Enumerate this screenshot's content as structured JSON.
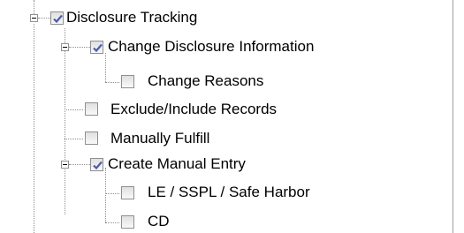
{
  "tree": {
    "items": [
      {
        "label": "Disclosure Tracking",
        "checked": true
      },
      {
        "label": "Change Disclosure Information",
        "checked": true
      },
      {
        "label": "Change Reasons",
        "checked": false
      },
      {
        "label": "Exclude/Include Records",
        "checked": false
      },
      {
        "label": "Manually Fulfill",
        "checked": false
      },
      {
        "label": "Create Manual Entry",
        "checked": true
      },
      {
        "label": "LE / SSPL / Safe Harbor",
        "checked": false
      },
      {
        "label": "CD",
        "checked": false
      }
    ]
  }
}
